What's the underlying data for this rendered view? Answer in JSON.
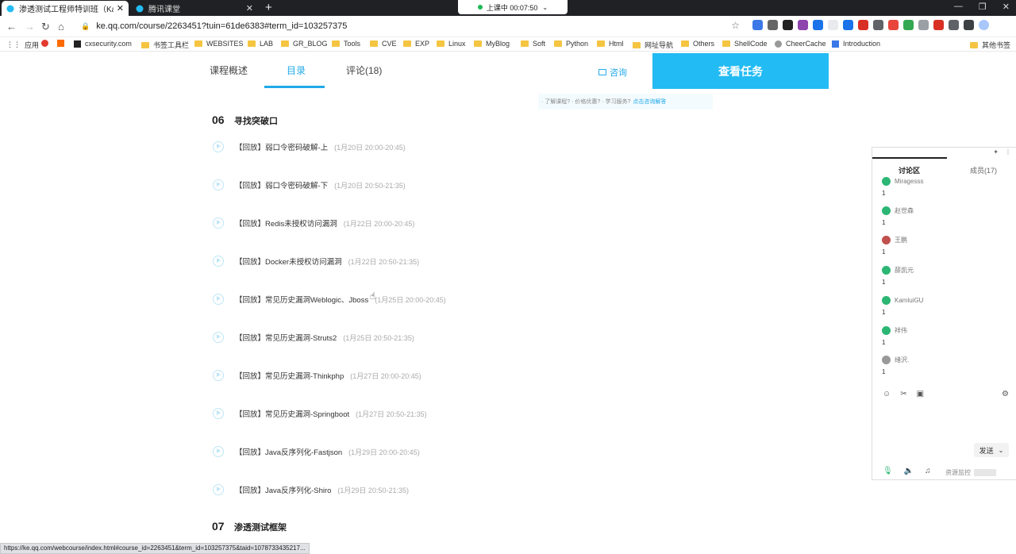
{
  "browser": {
    "tabs": [
      {
        "title": "渗透测试工程师特训班（Kali攻",
        "active": true
      },
      {
        "title": "腾讯课堂",
        "active": false
      }
    ],
    "recording": "上课中 00:07:50",
    "url": "ke.qq.com/course/2263451?tuin=61de6383#term_id=103257375",
    "bookmarks": [
      "应用",
      "cxsecurity.com",
      "书签工具栏",
      "WEBSITES",
      "LAB",
      "GR_BLOG",
      "Tools",
      "CVE",
      "EXP",
      "Linux",
      "MyBlog",
      "Soft",
      "Python",
      "Html",
      "网址导航",
      "Others",
      "ShellCode",
      "CheerCache",
      "Introduction",
      "其他书签"
    ]
  },
  "course_tabs": [
    "课程概述",
    "目录",
    "评论(18)"
  ],
  "consult_label": "咨询",
  "task_button": "查看任务",
  "faq": {
    "text": "· 了解课程? · 价格优惠? · 学习服务?",
    "link": "点击咨询解答"
  },
  "chapters": [
    {
      "num": "06",
      "title": "寻找突破口",
      "lessons": [
        {
          "title": "【回放】弱口令密码破解-上",
          "time": "(1月20日 20:00-20:45)"
        },
        {
          "title": "【回放】弱口令密码破解-下",
          "time": "(1月20日 20:50-21:35)"
        },
        {
          "title": "【回放】Redis未授权访问漏洞",
          "time": "(1月22日 20:00-20:45)"
        },
        {
          "title": "【回放】Docker未授权访问漏洞",
          "time": "(1月22日 20:50-21:35)"
        },
        {
          "title": "【回放】常见历史漏洞Weblogic、Jboss",
          "time": "(1月25日 20:00-20:45)"
        },
        {
          "title": "【回放】常见历史漏洞-Struts2",
          "time": "(1月25日 20:50-21:35)"
        },
        {
          "title": "【回放】常见历史漏洞-Thinkphp",
          "time": "(1月27日 20:00-20:45)"
        },
        {
          "title": "【回放】常见历史漏洞-Springboot",
          "time": "(1月27日 20:50-21:35)"
        },
        {
          "title": "【回放】Java反序列化-Fastjson",
          "time": "(1月29日 20:00-20:45)"
        },
        {
          "title": "【回放】Java反序列化-Shiro",
          "time": "(1月29日 20:50-21:35)"
        }
      ]
    },
    {
      "num": "07",
      "title": "渗透测试框架",
      "lessons": []
    }
  ],
  "discussion": {
    "tabs": [
      "讨论区",
      "成员(17)"
    ],
    "messages": [
      {
        "name": "Miragesss",
        "body": "1",
        "color": "#2bb673"
      },
      {
        "name": "赵世森",
        "body": "1",
        "color": "#2bb673"
      },
      {
        "name": "王鹏",
        "body": "1",
        "color": "#c0504d"
      },
      {
        "name": "薛凯元",
        "body": "1",
        "color": "#2bb673"
      },
      {
        "name": "KamluiGU",
        "body": "1",
        "color": "#2bb673"
      },
      {
        "name": "祥伟",
        "body": "1",
        "color": "#2bb673"
      },
      {
        "name": "绪沢.",
        "body": "1",
        "color": "#999999"
      }
    ],
    "send": "发送",
    "resource_monitor": "资源监控"
  },
  "status_url": "https://ke.qq.com/webcourse/index.html#course_id=2263451&term_id=103257375&taid=1078733435217..."
}
